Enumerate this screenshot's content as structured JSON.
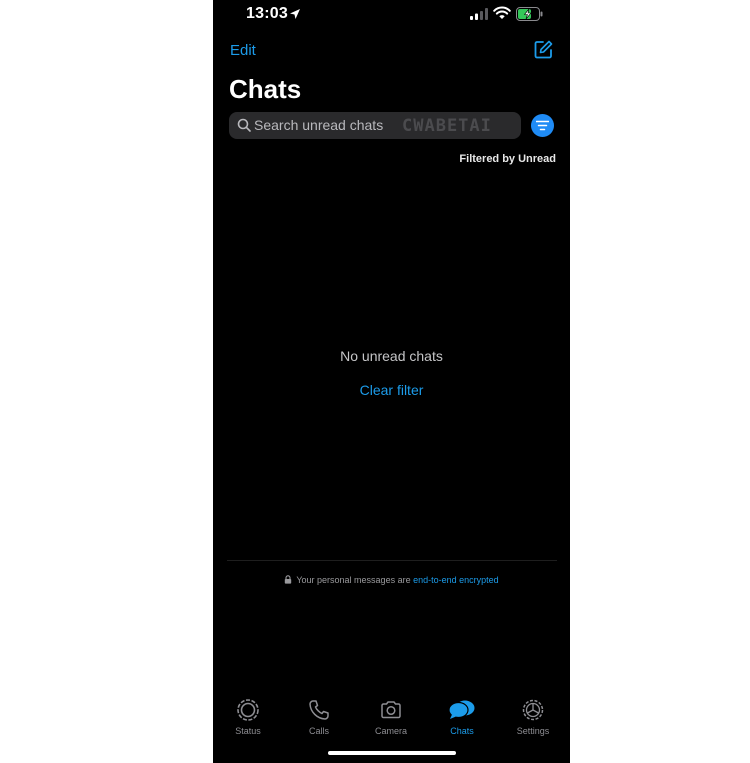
{
  "status_bar": {
    "time": "13:03",
    "icons": [
      "location-arrow-icon",
      "signal-icon",
      "wifi-icon",
      "battery-charging-icon"
    ]
  },
  "header": {
    "edit_label": "Edit",
    "compose_icon": "compose-icon",
    "title": "Chats"
  },
  "search": {
    "placeholder": "Search unread chats",
    "watermark": "CWABETAI",
    "filter_icon": "filter-icon"
  },
  "filter": {
    "caption": "Filtered by Unread"
  },
  "empty_state": {
    "message": "No unread chats",
    "action_label": "Clear filter"
  },
  "footer": {
    "lock_icon": "lock-icon",
    "encryption_text": "Your personal messages are ",
    "encryption_link": "end-to-end encrypted"
  },
  "tab_bar": {
    "tabs": [
      {
        "label": "Status",
        "icon": "status-icon",
        "active": false
      },
      {
        "label": "Calls",
        "icon": "phone-icon",
        "active": false
      },
      {
        "label": "Camera",
        "icon": "camera-icon",
        "active": false
      },
      {
        "label": "Chats",
        "icon": "chats-icon",
        "active": true
      },
      {
        "label": "Settings",
        "icon": "gear-icon",
        "active": false
      }
    ]
  },
  "colors": {
    "background": "#000000",
    "accent": "#1c9cea",
    "filter_button": "#1f8bf5",
    "search_bg": "#2a2a2c",
    "battery_fill": "#34c759",
    "inactive_tab": "#8e8e93"
  }
}
